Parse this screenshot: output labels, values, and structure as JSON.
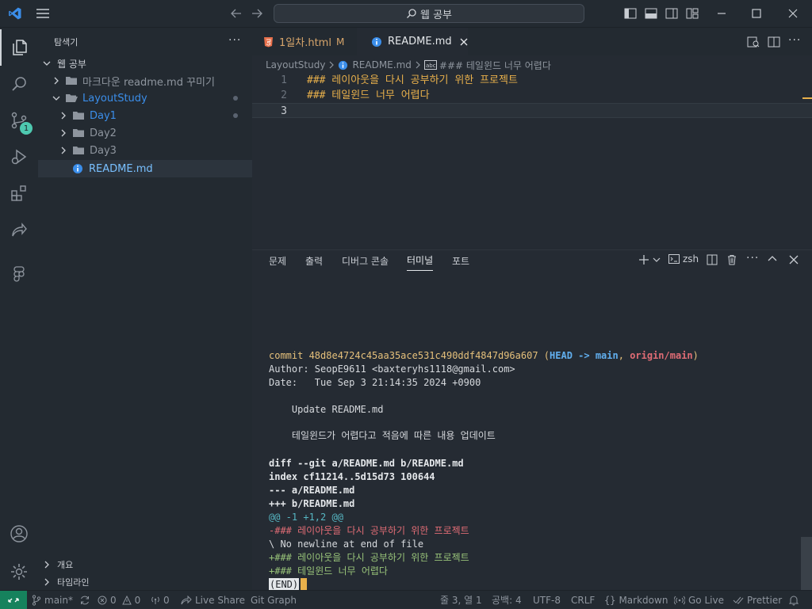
{
  "titlebar": {
    "search_label": "웹 공부"
  },
  "sidebar": {
    "title": "탐색기",
    "root_label": "웹 공부",
    "items": [
      {
        "label": "마크다운 readme.md 꾸미기",
        "kind": "folder",
        "depth": 1,
        "open": false
      },
      {
        "label": "LayoutStudy",
        "kind": "folder",
        "depth": 1,
        "open": true
      },
      {
        "label": "Day1",
        "kind": "folder",
        "depth": 2,
        "open": false
      },
      {
        "label": "Day2",
        "kind": "folder",
        "depth": 2,
        "open": false
      },
      {
        "label": "Day3",
        "kind": "folder",
        "depth": 2,
        "open": false
      },
      {
        "label": "README.md",
        "kind": "file",
        "depth": 2
      }
    ],
    "outline_label": "개요",
    "timeline_label": "타임라인"
  },
  "tabs": [
    {
      "label": "1일차.html",
      "badge": "M"
    },
    {
      "label": "README.md",
      "badge": ""
    }
  ],
  "breadcrumb": [
    "LayoutStudy",
    "README.md",
    "### 테일윈드 너무 어렵다"
  ],
  "editor": {
    "lines": [
      {
        "num": "1",
        "text": "### 레이아웃을 다시 공부하기 위한 프로젝트"
      },
      {
        "num": "2",
        "text": "### 테일윈드 너무 어렵다"
      },
      {
        "num": "3",
        "text": ""
      }
    ]
  },
  "panel": {
    "tabs": [
      "문제",
      "출력",
      "디버그 콘솔",
      "터미널",
      "포트"
    ],
    "active_tab": "터미널",
    "shell_label": "zsh"
  },
  "terminal": {
    "commit_prefix": "commit 48d8e4724c45aa35ace531c490ddf4847d96a607",
    "head_text": "HEAD -> main",
    "origin_text": "origin/main",
    "author": "Author: SeopE9611 <baxteryhs1118@gmail.com>",
    "date": "Date:   Tue Sep 3 21:14:35 2024 +0900",
    "message_1": "    Update README.md",
    "message_2": "    테일윈드가 어렵다고 적음에 따른 내용 업데이트",
    "diff_header": "diff --git a/README.md b/README.md",
    "index": "index cf11214..5d15d73 100644",
    "minus_file": "--- a/README.md",
    "plus_file": "+++ b/README.md",
    "hunk": "@@ -1 +1,2 @@",
    "removed": "-### 레이아웃을 다시 공부하기 위한 프로젝트",
    "no_newline": "\\ No newline at end of file",
    "added_1": "+### 레이아웃을 다시 공부하기 위한 프로젝트",
    "added_2": "+### 테일윈드 너무 어렵다",
    "end": "(END)"
  },
  "statusbar": {
    "branch": "main*",
    "errors": "0",
    "warnings": "0",
    "ports": "0",
    "live_share": "Live Share",
    "git_graph": "Git Graph",
    "position": "줄 3, 열 1",
    "spaces": "공백: 4",
    "encoding": "UTF-8",
    "eol": "CRLF",
    "language": "Markdown",
    "go_live": "Go Live",
    "prettier": "Prettier"
  },
  "scm_badge": "1",
  "colors": {
    "accent_blue": "#3b8eea",
    "md_heading": "#e8b04b",
    "term_yellow": "#e5c07b",
    "term_head": "#61afef",
    "term_green": "#98c379",
    "term_red": "#e06c75",
    "hunk_blue": "#56b6c2",
    "remote_green": "#16825d"
  }
}
